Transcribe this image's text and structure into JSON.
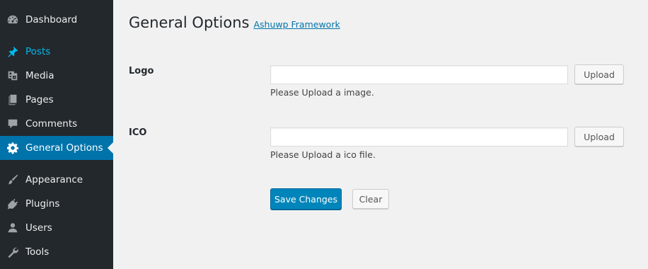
{
  "sidebar": {
    "items": [
      {
        "label": "Dashboard",
        "icon": "dashboard-icon"
      },
      {
        "label": "Posts",
        "icon": "pushpin-icon"
      },
      {
        "label": "Media",
        "icon": "media-icon"
      },
      {
        "label": "Pages",
        "icon": "pages-icon"
      },
      {
        "label": "Comments",
        "icon": "comment-icon"
      },
      {
        "label": "General Options",
        "icon": "gear-icon"
      },
      {
        "label": "Appearance",
        "icon": "paintbrush-icon"
      },
      {
        "label": "Plugins",
        "icon": "plugin-icon"
      },
      {
        "label": "Users",
        "icon": "user-icon"
      },
      {
        "label": "Tools",
        "icon": "wrench-icon"
      }
    ]
  },
  "page": {
    "title": "General Options",
    "subtitle": "Ashuwp Framework"
  },
  "fields": [
    {
      "label": "Logo",
      "value": "",
      "placeholder": "",
      "button": "Upload",
      "hint": "Please Upload a image."
    },
    {
      "label": "ICO",
      "value": "",
      "placeholder": "",
      "button": "Upload",
      "hint": "Please Upload a ico file."
    }
  ],
  "actions": {
    "save": "Save Changes",
    "clear": "Clear"
  },
  "colors": {
    "sidebar_bg": "#23282d",
    "active_menu_bg": "#0073aa",
    "highlight_text": "#00b9eb",
    "primary_button": "#0085ba",
    "content_bg": "#f1f1f1"
  }
}
